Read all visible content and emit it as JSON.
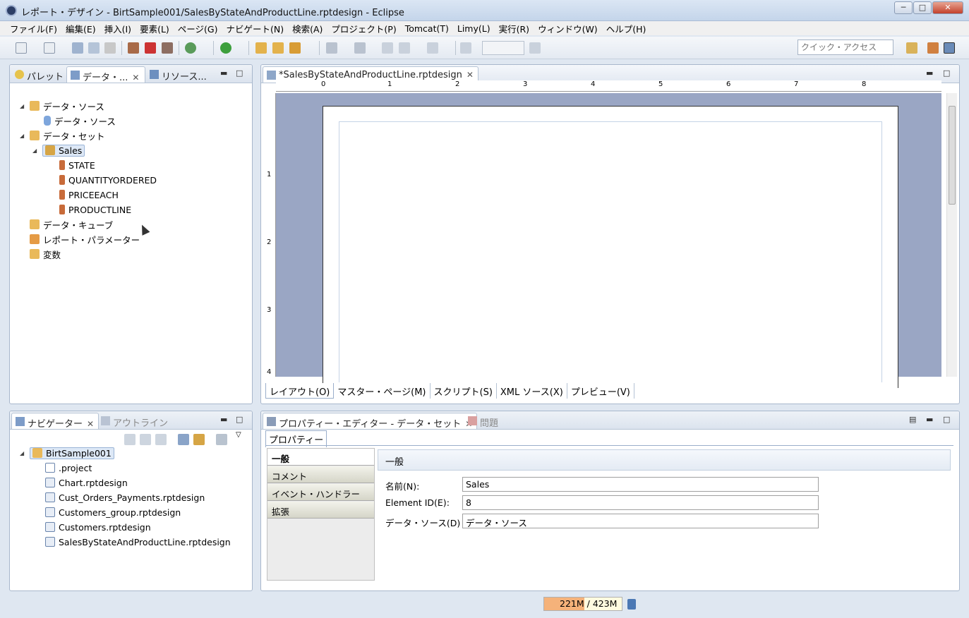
{
  "window": {
    "title": "レポート・デザイン - BirtSample001/SalesByStateAndProductLine.rptdesign - Eclipse",
    "minimize": "─",
    "maximize": "□",
    "close": "✕"
  },
  "menu": [
    "ファイル(F)",
    "編集(E)",
    "挿入(I)",
    "要素(L)",
    "ページ(G)",
    "ナビゲート(N)",
    "検索(A)",
    "プロジェクト(P)",
    "Tomcat(T)",
    "Limy(L)",
    "実行(R)",
    "ウィンドウ(W)",
    "ヘルプ(H)"
  ],
  "toolbar": {
    "quick_access_placeholder": "クイック・アクセス"
  },
  "left_panel": {
    "tabs": [
      {
        "label": "パレット",
        "icon": "palette-icon"
      },
      {
        "label": "データ・...",
        "icon": "data-explorer-icon"
      },
      {
        "label": "リソース...",
        "icon": "resource-explorer-icon"
      }
    ],
    "tree": [
      {
        "label": "データ・ソース",
        "level": 0,
        "expanded": true,
        "icon": "data-sources-icon"
      },
      {
        "label": "データ・ソース",
        "level": 1,
        "icon": "data-source-icon"
      },
      {
        "label": "データ・セット",
        "level": 0,
        "expanded": true,
        "icon": "data-sets-icon"
      },
      {
        "label": "Sales",
        "level": 1,
        "expanded": true,
        "selected": true,
        "icon": "data-set-icon"
      },
      {
        "label": "STATE",
        "level": 2,
        "icon": "column-icon"
      },
      {
        "label": "QUANTITYORDERED",
        "level": 2,
        "icon": "column-icon"
      },
      {
        "label": "PRICEEACH",
        "level": 2,
        "icon": "column-icon"
      },
      {
        "label": "PRODUCTLINE",
        "level": 2,
        "icon": "column-icon"
      },
      {
        "label": "データ・キューブ",
        "level": 0,
        "icon": "cube-icon"
      },
      {
        "label": "レポート・パラメーター",
        "level": 0,
        "icon": "parameter-icon"
      },
      {
        "label": "変数",
        "level": 0,
        "icon": "variable-icon"
      }
    ]
  },
  "editor": {
    "tab": "*SalesByStateAndProductLine.rptdesign",
    "ruler_h": [
      "0",
      "1",
      "2",
      "3",
      "4",
      "5",
      "6",
      "7",
      "8"
    ],
    "ruler_v": [
      "1",
      "2",
      "3",
      "4"
    ],
    "bottom_tabs": [
      "レイアウト(O)",
      "マスター・ページ(M)",
      "スクリプト(S)",
      "XML ソース(X)",
      "プレビュー(V)"
    ]
  },
  "navigator": {
    "tabs": [
      {
        "label": "ナビゲーター"
      },
      {
        "label": "アウトライン"
      }
    ],
    "project": "BirtSample001",
    "files": [
      ".project",
      "Chart.rptdesign",
      "Cust_Orders_Payments.rptdesign",
      "Customers_group.rptdesign",
      "Customers.rptdesign",
      "SalesByStateAndProductLine.rptdesign"
    ]
  },
  "properties": {
    "tab": "プロパティー・エディター - データ・セット",
    "problems_tab": "問題",
    "subtab": "プロパティー",
    "categories": [
      "一般",
      "コメント",
      "イベント・ハンドラー",
      "拡張"
    ],
    "section_title": "一般",
    "fields": [
      {
        "label": "名前(N):",
        "value": "Sales"
      },
      {
        "label": "Element ID(E):",
        "value": "8"
      },
      {
        "label": "データ・ソース(D)",
        "value": "データ・ソース"
      }
    ]
  },
  "status": {
    "heap_used": "221M",
    "heap_total": "423M",
    "heap_fraction": 0.52
  }
}
